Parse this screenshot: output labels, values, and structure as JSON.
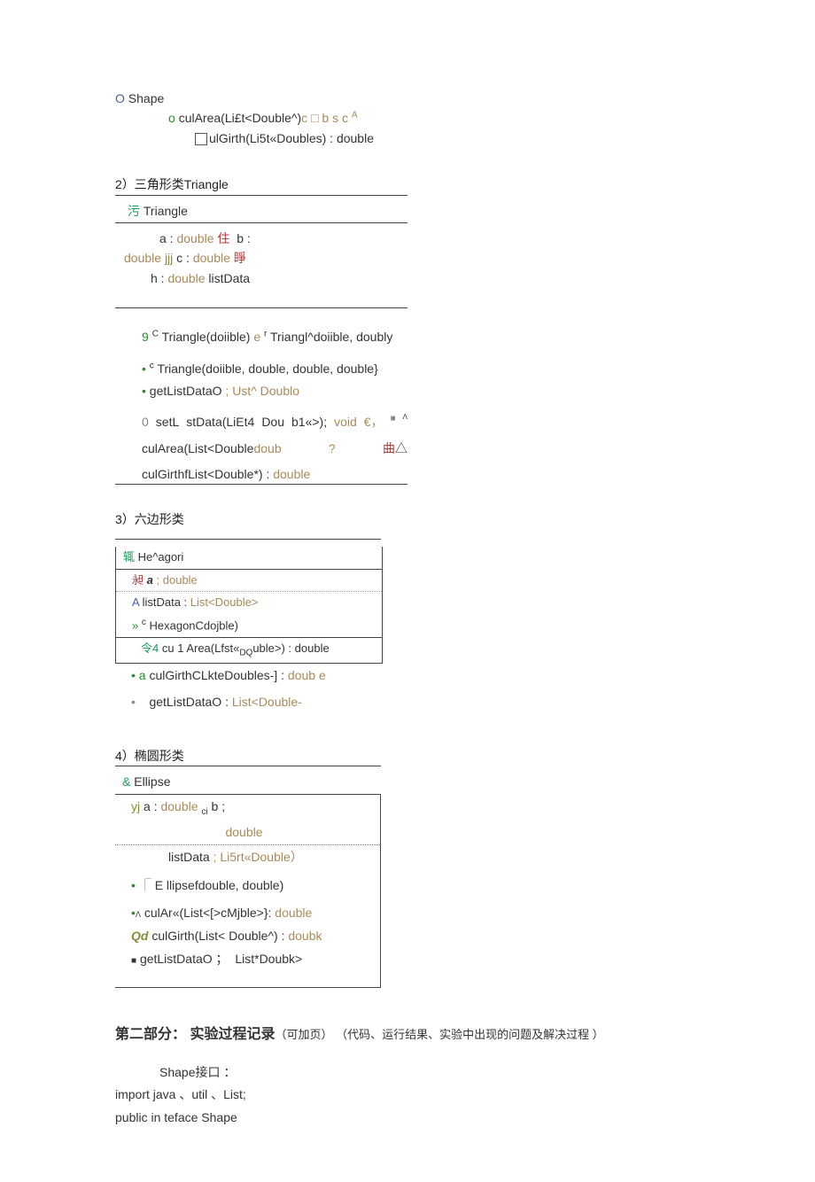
{
  "shape_block": {
    "title_icon": "O",
    "title": "Shape",
    "line1_icon": "o",
    "line1_pre": "culArea(Li£t<Double^)",
    "line1_c": "c",
    "line1_sq": "□",
    "line1_bsc": "b s c",
    "line1_A": "A",
    "line2_pre": "ulGirth(Li5t«Doubles) : double"
  },
  "triangle": {
    "hdr": "2）三角形类Triangle",
    "title_icon": "污",
    "title": "Triangle",
    "a": "a :",
    "a_type": "double",
    "zhu": "住",
    "b_label": "b :",
    "b_pre": "double",
    "jjj": "jjj",
    "c_label": "c :",
    "c_type": "double",
    "hun": "睜",
    "h_label": "h :",
    "h_type": "double",
    "listdata": "listData",
    "c1_pre": "9",
    "c1_c": "C",
    "c1_text": "Triangle(doiible)",
    "c1_e": "e",
    "c1_r": "r",
    "c1_rest": "Triangl^doiible, doubly",
    "c2_pre": "•",
    "c2_c": "c",
    "c2_text": "Triangle(doiible, double, double, double}",
    "c3_pre": "•",
    "c3_text": "getListDataO",
    "c3_semi": ";",
    "c3_type": "Ust^ Doublo",
    "c4_pre": "0",
    "c4_a": "setL",
    "c4_b": "stData(LiEt4",
    "c4_c": "Dou",
    "c4_d": "b1«>);",
    "c4_e": "void",
    "c4_euro": "€，",
    "c4_sq": "■",
    "c4_tri": "Λ",
    "c5_a": "culArea(List<Double",
    "c5_b": "doub",
    "c5_q": "?",
    "c5_qu": "曲",
    "c5_tri": "△",
    "c6_a": "culGirthfList<Double*) :",
    "c6_type": "double"
  },
  "hexagon": {
    "hdr": "3）六边形类",
    "title_icon": "辄",
    "title": "He^agori",
    "r1_icon": "昶",
    "r1_a": "a",
    "r1_semi": ";",
    "r1_type": "double",
    "r2_icon": "A",
    "r2_text": "listData :",
    "r2_type": "List<Double>",
    "r3_icon": "»",
    "r3_c": "c",
    "r3_text": "HexagonCdojble)",
    "r4_icon": "令4",
    "r4_text": "cu 1 Area(Lfst«",
    "r4_text_sub": "DQ",
    "r4_text2": "uble>) : double",
    "r5_pre": "• a",
    "r5_text": "culGirthCLkteDoubles-] :",
    "r5_type": "doub e",
    "r6_bullet": "•",
    "r6_text": "getListDataO :",
    "r6_type": "List<Double-"
  },
  "ellipse": {
    "hdr": "4）椭圆形类",
    "title_icon": "&",
    "title": "Ellipse",
    "r1_icon": "yj",
    "r1_a": "a :",
    "r1_type": "double",
    "r1_ci": "ci",
    "r1_b": "b ;",
    "r1b_type": "double",
    "r2_text": "listData",
    "r2_semi": ";",
    "r2_type": "Li5rt«Double）",
    "r3_pre": "•",
    "r3_box": "⎾",
    "r3_text": "E llipsefdouble, double)",
    "r4_pre": "•",
    "r4_sup": "Λ",
    "r4_text": "culAr«(List<[>cMjble>}:",
    "r4_type": "double",
    "r5_icon": "Qd",
    "r5_text": "culGirth(List< Double^) :",
    "r5_type": "doubk",
    "r6_icon": "■",
    "r6_text": "getListDataO ；",
    "r6_type": "List*Doubk>"
  },
  "section2": {
    "title_bold": "第二部分： 实验过程记录",
    "title_rest": "（可加页） （代码、运行结果、实验中出现的问题及解决过程 ）",
    "line1": "Shape接口 ：",
    "line2": "import java 、util 、List;",
    "line3": "public in teface Shape"
  }
}
